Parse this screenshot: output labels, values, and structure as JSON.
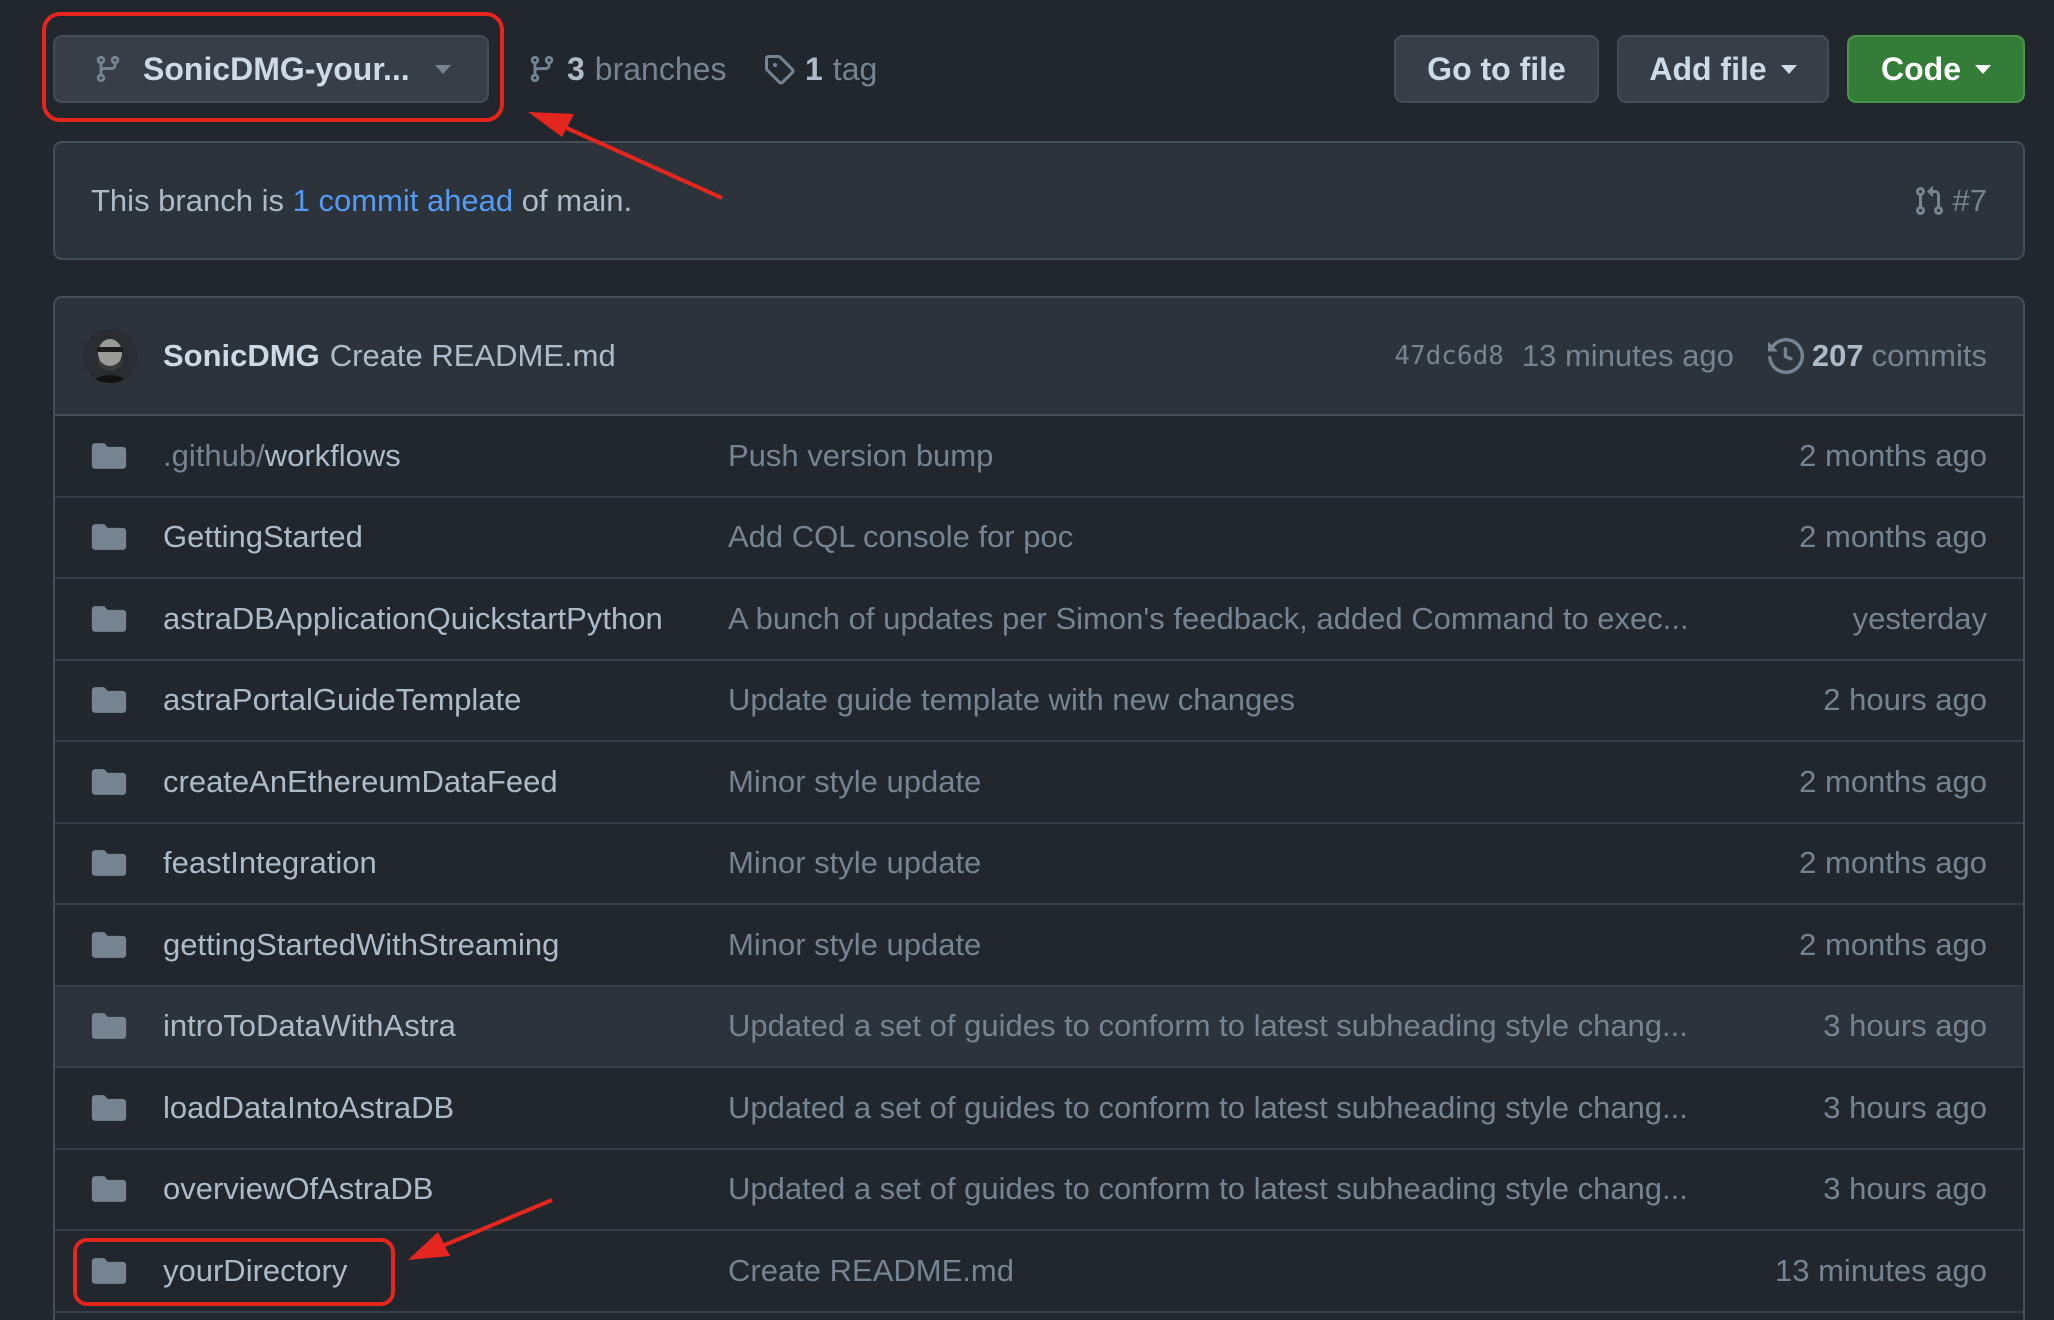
{
  "toolbar": {
    "branch_name": "SonicDMG-your...",
    "branches_count": "3",
    "branches_label": "branches",
    "tags_count": "1",
    "tags_label": "tag",
    "go_to_file": "Go to file",
    "add_file": "Add file",
    "code": "Code"
  },
  "branch_info": {
    "prefix": "This branch is",
    "link": "1 commit ahead",
    "suffix": "of main.",
    "pr": "#7"
  },
  "latest_commit": {
    "author": "SonicDMG",
    "message": "Create README.md",
    "sha": "47dc6d8",
    "time": "13 minutes ago",
    "commit_count": "207",
    "commits_label": "commits"
  },
  "files": [
    {
      "name_dim": ".github/",
      "name": "workflows",
      "message": "Push version bump",
      "age": "2 months ago"
    },
    {
      "name_dim": "",
      "name": "GettingStarted",
      "message": "Add CQL console for poc",
      "age": "2 months ago"
    },
    {
      "name_dim": "",
      "name": "astraDBApplicationQuickstartPython",
      "message": "A bunch of updates per Simon's feedback, added Command to exec...",
      "age": "yesterday"
    },
    {
      "name_dim": "",
      "name": "astraPortalGuideTemplate",
      "message": "Update guide template with new changes",
      "age": "2 hours ago"
    },
    {
      "name_dim": "",
      "name": "createAnEthereumDataFeed",
      "message": "Minor style update",
      "age": "2 months ago"
    },
    {
      "name_dim": "",
      "name": "feastIntegration",
      "message": "Minor style update",
      "age": "2 months ago"
    },
    {
      "name_dim": "",
      "name": "gettingStartedWithStreaming",
      "message": "Minor style update",
      "age": "2 months ago"
    },
    {
      "name_dim": "",
      "name": "introToDataWithAstra",
      "message": "Updated a set of guides to conform to latest subheading style chang...",
      "age": "3 hours ago"
    },
    {
      "name_dim": "",
      "name": "loadDataIntoAstraDB",
      "message": "Updated a set of guides to conform to latest subheading style chang...",
      "age": "3 hours ago"
    },
    {
      "name_dim": "",
      "name": "overviewOfAstraDB",
      "message": "Updated a set of guides to conform to latest subheading style chang...",
      "age": "3 hours ago"
    },
    {
      "name_dim": "",
      "name": "yourDirectory",
      "message": "Create README.md",
      "age": "13 minutes ago"
    }
  ],
  "colors": {
    "background": "#22272e",
    "surface": "#2d333b",
    "link": "#539bf5",
    "code_button": "#347d39",
    "annotation": "#e5261f"
  },
  "icons": [
    "git-branch-icon",
    "tag-icon",
    "git-pull-request-icon",
    "history-icon",
    "folder-icon",
    "avatar"
  ]
}
